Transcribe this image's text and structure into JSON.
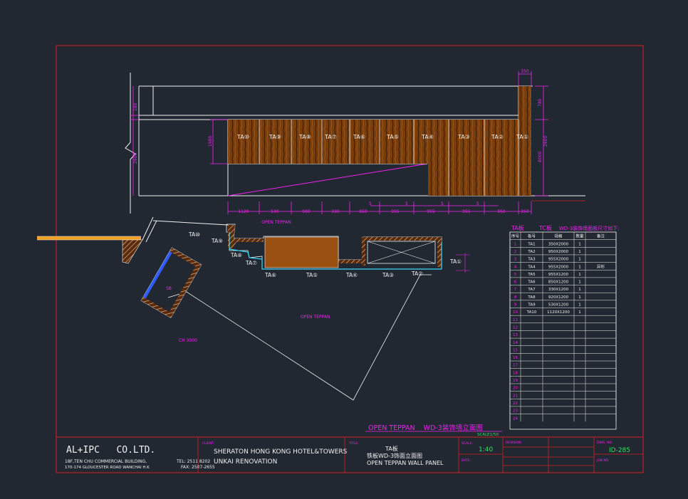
{
  "drawing": {
    "elevation": {
      "top_dim": "350",
      "left_dims": [
        "180",
        "1980",
        "2600"
      ],
      "right_dims": [
        "780",
        "8000",
        "2600"
      ],
      "bottom_dims": [
        "1120",
        "530",
        "980",
        "330",
        "850",
        "955",
        "955",
        "955",
        "950",
        "350"
      ],
      "small_s": [
        "5",
        "5",
        "5",
        "5"
      ],
      "panel_tags": [
        "TA⑩",
        "TA⑨",
        "TA⑧",
        "TA⑦",
        "TA⑥",
        "TA⑤",
        "TA④",
        "TA③",
        "TA②",
        "TA①"
      ],
      "label": "OPEN TEPPAN"
    },
    "plan": {
      "tags_upper": [
        "TA⑩",
        "TA⑨",
        "TA⑧",
        "TA⑦"
      ],
      "tags_lower": [
        "TA⑥",
        "TA⑤",
        "TA④",
        "TA③",
        "TA②",
        "TA①"
      ],
      "sb_label": "SB",
      "area_label": "OPEN TEPPAN",
      "ch_label": "CH 3000"
    },
    "schedule": {
      "title_left": "TA板",
      "title_mid": "TC板",
      "title_right": "WD-3装饰墙面板尺寸如下:",
      "headers": [
        "序号",
        "板号",
        "规格",
        "数量",
        "备注"
      ],
      "rows": [
        [
          "1",
          "TA1",
          "350X2000",
          "1",
          ""
        ],
        [
          "2",
          "TA2",
          "950X2000",
          "1",
          ""
        ],
        [
          "3",
          "TA3",
          "955X2000",
          "1",
          ""
        ],
        [
          "4",
          "TA4",
          "955X2000",
          "1",
          "异形"
        ],
        [
          "5",
          "TA5",
          "955X1200",
          "1",
          ""
        ],
        [
          "6",
          "TA6",
          "850X1200",
          "1",
          ""
        ],
        [
          "7",
          "TA7",
          "330X1200",
          "1",
          ""
        ],
        [
          "8",
          "TA8",
          "920X1200",
          "1",
          ""
        ],
        [
          "9",
          "TA9",
          "530X1200",
          "1",
          ""
        ],
        [
          "10",
          "TA10",
          "1120X1200",
          "1",
          ""
        ],
        [
          "11"
        ],
        [
          "12"
        ],
        [
          "13"
        ],
        [
          "14"
        ],
        [
          "15"
        ],
        [
          "16"
        ],
        [
          "17"
        ],
        [
          "18"
        ],
        [
          "19"
        ],
        [
          "20"
        ],
        [
          "21"
        ],
        [
          "22"
        ],
        [
          "23"
        ],
        [
          "24"
        ]
      ]
    },
    "caption": {
      "title": "OPEN TEPPAN    WD-3装饰墙立面图",
      "scale": "SCALE1/50"
    }
  },
  "title_block": {
    "company": "AL+IPC   CO.LTD.",
    "address1": "18F,TEN CHU COMMERCIAL BUILDING,",
    "address2": "170-174 GLOUCESTER ROAD WANCHAI H.K",
    "tel": "TEL: 2511 8202",
    "fax": "FAX: 2507-2655",
    "client_label": "CLIENT:",
    "client1": "SHERATON HONG KONG HOTEL&TOWERS",
    "client2": "UNKAI RENOVATION",
    "title_label": "TITLE:",
    "title_ta": "TA板",
    "title_cn": "铁板WD-3饰面立面图",
    "title_en": "OPEN TEPPAN WALL PANEL",
    "scale_label": "SCALE:",
    "scale_value": "1:40",
    "date_label": "DATE:",
    "revision_label": "REVISION:",
    "dwg_label": "DWG. NO.",
    "dwg_value": "ID-285",
    "job_label": "JOB NO."
  },
  "colors": {
    "background": "#222831",
    "frame": "#d42020",
    "magenta": "#ee22ee",
    "white": "#f0f0f0",
    "wood": "#8a4a12",
    "cyan": "#3ad8ff",
    "green": "#30e060"
  }
}
